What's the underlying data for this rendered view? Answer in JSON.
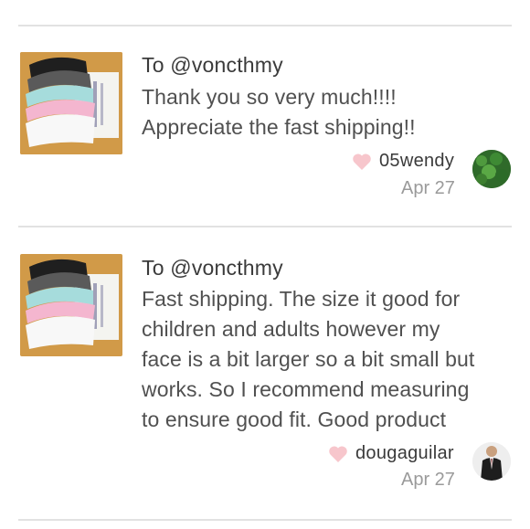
{
  "reviews": [
    {
      "to_line": "To @voncthmy",
      "message_lines": [
        "Thank you so very much!!!!",
        "Appreciate the fast shipping!!"
      ],
      "author": "05wendy",
      "date": "Apr 27",
      "avatar_icon": "grass-avatar-icon",
      "thumbnail": "masks-product-photo"
    },
    {
      "to_line": "To @voncthmy",
      "message_lines": [
        "Fast shipping. The size it good for",
        "children and adults however my",
        "face is a bit larger so a bit small but",
        "works. So I recommend measuring",
        "to ensure good fit. Good product"
      ],
      "author": "dougaguilar",
      "date": "Apr 27",
      "avatar_icon": "man-in-suit-avatar-icon",
      "thumbnail": "masks-product-photo"
    }
  ],
  "colors": {
    "heart": "#f7c6cc",
    "divider": "#e2e2e2",
    "date": "#9a9a9a"
  }
}
